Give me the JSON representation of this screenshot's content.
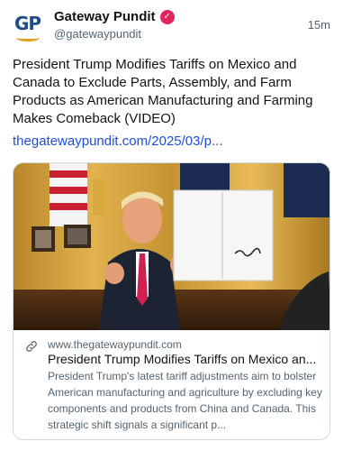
{
  "account": {
    "avatar_text": "GP",
    "display_name": "Gateway Pundit",
    "handle": "@gatewaypundit",
    "timestamp": "15m",
    "verified_color": "#e0245e"
  },
  "post": {
    "text": "President Trump Modifies Tariffs on Mexico and Canada to Exclude Parts, Assembly, and Farm Products as American Manufacturing and Farming Makes Comeback (VIDEO)",
    "link_text": "thegatewaypundit.com/2025/03/p..."
  },
  "card": {
    "domain": "www.thegatewaypundit.com",
    "title": "President Trump Modifies Tariffs on Mexico an...",
    "description": "President Trump's latest tariff adjustments aim to bolster American manufacturing and agriculture by excluding key components and products from China and Canada. This strategic shift signals a significant p..."
  },
  "colors": {
    "link": "#1d4fd8",
    "secondary_text": "#536471",
    "border": "#cfd9de"
  }
}
